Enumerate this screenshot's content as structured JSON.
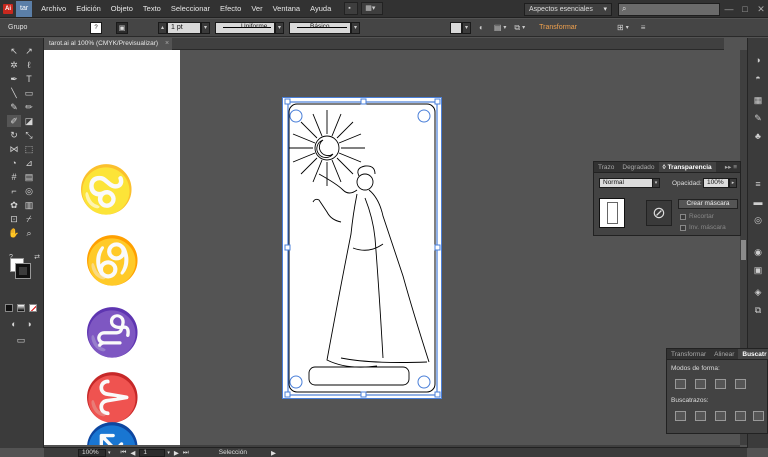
{
  "app": {
    "logo": "Ai",
    "tab": "tar"
  },
  "menu": [
    "Archivo",
    "Edición",
    "Objeto",
    "Texto",
    "Seleccionar",
    "Efecto",
    "Ver",
    "Ventana",
    "Ayuda"
  ],
  "workspace": {
    "label": "Aspectos esenciales",
    "arrow": "▾"
  },
  "search": {
    "icon": "search-icon",
    "placeholder": ""
  },
  "window_controls": [
    "—",
    "□",
    "✕"
  ],
  "control_bar": {
    "selection_type": "Grupo",
    "stroke_label": "Trazo",
    "stroke_weight": "1 pt",
    "stroke_profile": "Uniforme",
    "brush": "Básico",
    "transform": "Transformar"
  },
  "document": {
    "tab_title": "tarot.ai al 100% (CMYK/Previsualizar)",
    "close": "×"
  },
  "status_bar": {
    "zoom": "100%",
    "page": "1",
    "tool": "Selección"
  },
  "transparency_panel": {
    "tabs": [
      "Trazo",
      "Degradado",
      "◊ Transparencia"
    ],
    "active_tab": 2,
    "blend_mode": "Normal",
    "opacity_label": "Opacidad:",
    "opacity_value": "100%",
    "make_mask": "Crear máscara",
    "clip": "Recortar",
    "invert_mask": "Inv. máscara"
  },
  "pathfinder_panel": {
    "tabs": [
      "Transformar",
      "Alinear",
      "Buscatr"
    ],
    "active_tab": 2,
    "shape_modes_label": "Modos de forma:",
    "pathfinders_label": "Buscatrazos:"
  },
  "colors": {
    "accent": "#f0a14e",
    "selection": "#4a7fd8",
    "panel": "#434343",
    "canvas": "#545454"
  }
}
